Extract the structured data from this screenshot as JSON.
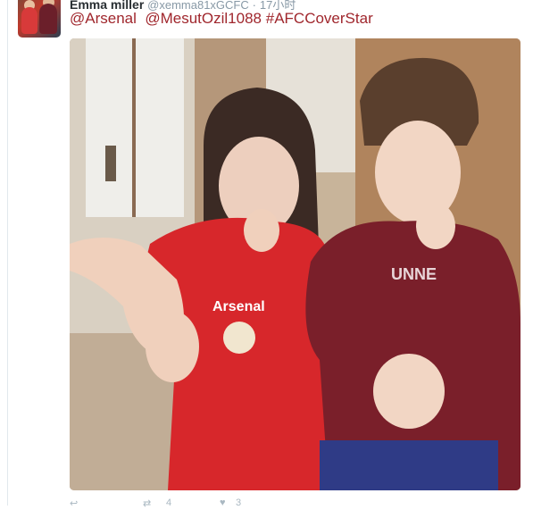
{
  "tweet": {
    "author_name": "Emma miller",
    "author_handle": "@xemma81xGCFC",
    "separator": "·",
    "time": "17小时",
    "text_mentions": [
      "@Arsenal",
      "@MesutOzil1088",
      "#AFCCoverStar"
    ],
    "retweet_count": "4",
    "like_count": "3"
  },
  "media": {
    "shirt_text": "Arsenal",
    "hoodie_text": "UNNE"
  },
  "colors": {
    "link": "#a0272d",
    "name": "#292f33",
    "muted": "#8899a6"
  },
  "icons": [
    "reply-icon",
    "retweet-icon",
    "like-icon"
  ]
}
